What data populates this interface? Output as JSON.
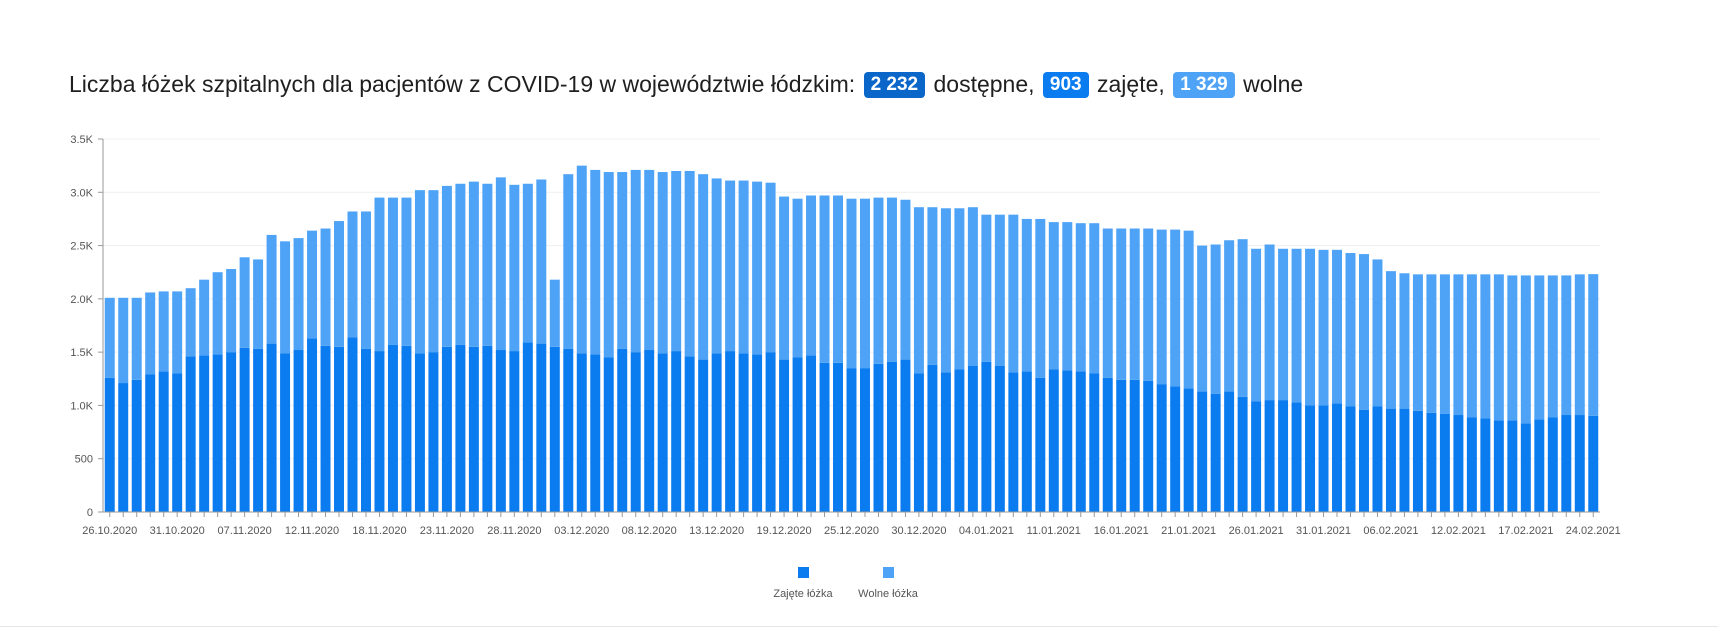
{
  "headline": {
    "prefix": "Liczba łóżek szpitalnych dla pacjentów z COVID-19 w województwie łódzkim:",
    "total_value": "2 232",
    "total_label": "dostępne,",
    "occupied_value": "903",
    "occupied_label": "zajęte,",
    "free_value": "1 329",
    "free_label": "wolne"
  },
  "colors": {
    "occupied": "#0b7cf0",
    "free": "#4ea3f6"
  },
  "chart_data": {
    "type": "bar",
    "stacked": true,
    "ylim": [
      0,
      3500
    ],
    "y_ticks": [
      0,
      500,
      1000,
      1500,
      2000,
      2500,
      3000,
      3500
    ],
    "y_tick_labels": [
      "0",
      "500",
      "1.0K",
      "1.5K",
      "2.0K",
      "2.5K",
      "3.0K",
      "3.5K"
    ],
    "x_tick_labels": [
      "26.10.2020",
      "31.10.2020",
      "07.11.2020",
      "12.11.2020",
      "18.11.2020",
      "23.11.2020",
      "28.11.2020",
      "03.12.2020",
      "08.12.2020",
      "13.12.2020",
      "19.12.2020",
      "25.12.2020",
      "30.12.2020",
      "04.01.2021",
      "11.01.2021",
      "16.01.2021",
      "21.01.2021",
      "26.01.2021",
      "31.01.2021",
      "06.02.2021",
      "12.02.2021",
      "17.02.2021",
      "24.02.2021"
    ],
    "legend_position": "bottom",
    "series": [
      {
        "name": "Zajęte łóżka",
        "color": "#0b7cf0",
        "values": [
          1260,
          1210,
          1240,
          1290,
          1320,
          1300,
          1460,
          1470,
          1480,
          1500,
          1540,
          1530,
          1580,
          1490,
          1520,
          1630,
          1560,
          1550,
          1640,
          1530,
          1510,
          1570,
          1560,
          1490,
          1500,
          1550,
          1570,
          1550,
          1560,
          1520,
          1510,
          1590,
          1580,
          1550,
          1530,
          1490,
          1480,
          1450,
          1530,
          1500,
          1520,
          1490,
          1510,
          1460,
          1430,
          1490,
          1510,
          1490,
          1480,
          1500,
          1430,
          1450,
          1470,
          1400,
          1400,
          1350,
          1350,
          1390,
          1410,
          1430,
          1300,
          1380,
          1310,
          1340,
          1370,
          1410,
          1370,
          1310,
          1320,
          1260,
          1340,
          1330,
          1320,
          1300,
          1260,
          1240,
          1240,
          1230,
          1200,
          1180,
          1160,
          1130,
          1110,
          1130,
          1080,
          1040,
          1050,
          1050,
          1030,
          1000,
          1000,
          1020,
          990,
          960,
          990,
          970,
          970,
          950,
          930,
          920,
          910,
          890,
          880,
          860,
          860,
          830,
          870,
          890,
          910,
          910,
          903
        ]
      },
      {
        "name": "Wolne łóżka",
        "color": "#4ea3f6",
        "values": [
          750,
          800,
          770,
          770,
          750,
          770,
          640,
          710,
          770,
          780,
          850,
          840,
          1020,
          1050,
          1050,
          1010,
          1100,
          1180,
          1180,
          1290,
          1440,
          1380,
          1390,
          1530,
          1520,
          1510,
          1510,
          1550,
          1520,
          1620,
          1560,
          1490,
          1540,
          630,
          1640,
          1760,
          1730,
          1740,
          1660,
          1710,
          1690,
          1700,
          1690,
          1740,
          1740,
          1640,
          1600,
          1620,
          1620,
          1590,
          1530,
          1490,
          1500,
          1570,
          1570,
          1590,
          1590,
          1560,
          1540,
          1500,
          1560,
          1480,
          1540,
          1510,
          1490,
          1380,
          1420,
          1480,
          1430,
          1490,
          1380,
          1390,
          1390,
          1410,
          1400,
          1420,
          1420,
          1430,
          1450,
          1470,
          1480,
          1370,
          1400,
          1420,
          1480,
          1430,
          1460,
          1420,
          1440,
          1470,
          1460,
          1440,
          1440,
          1460,
          1380,
          1290,
          1270,
          1280,
          1300,
          1310,
          1320,
          1340,
          1350,
          1370,
          1360,
          1390,
          1350,
          1330,
          1310,
          1320,
          1329
        ]
      }
    ]
  }
}
